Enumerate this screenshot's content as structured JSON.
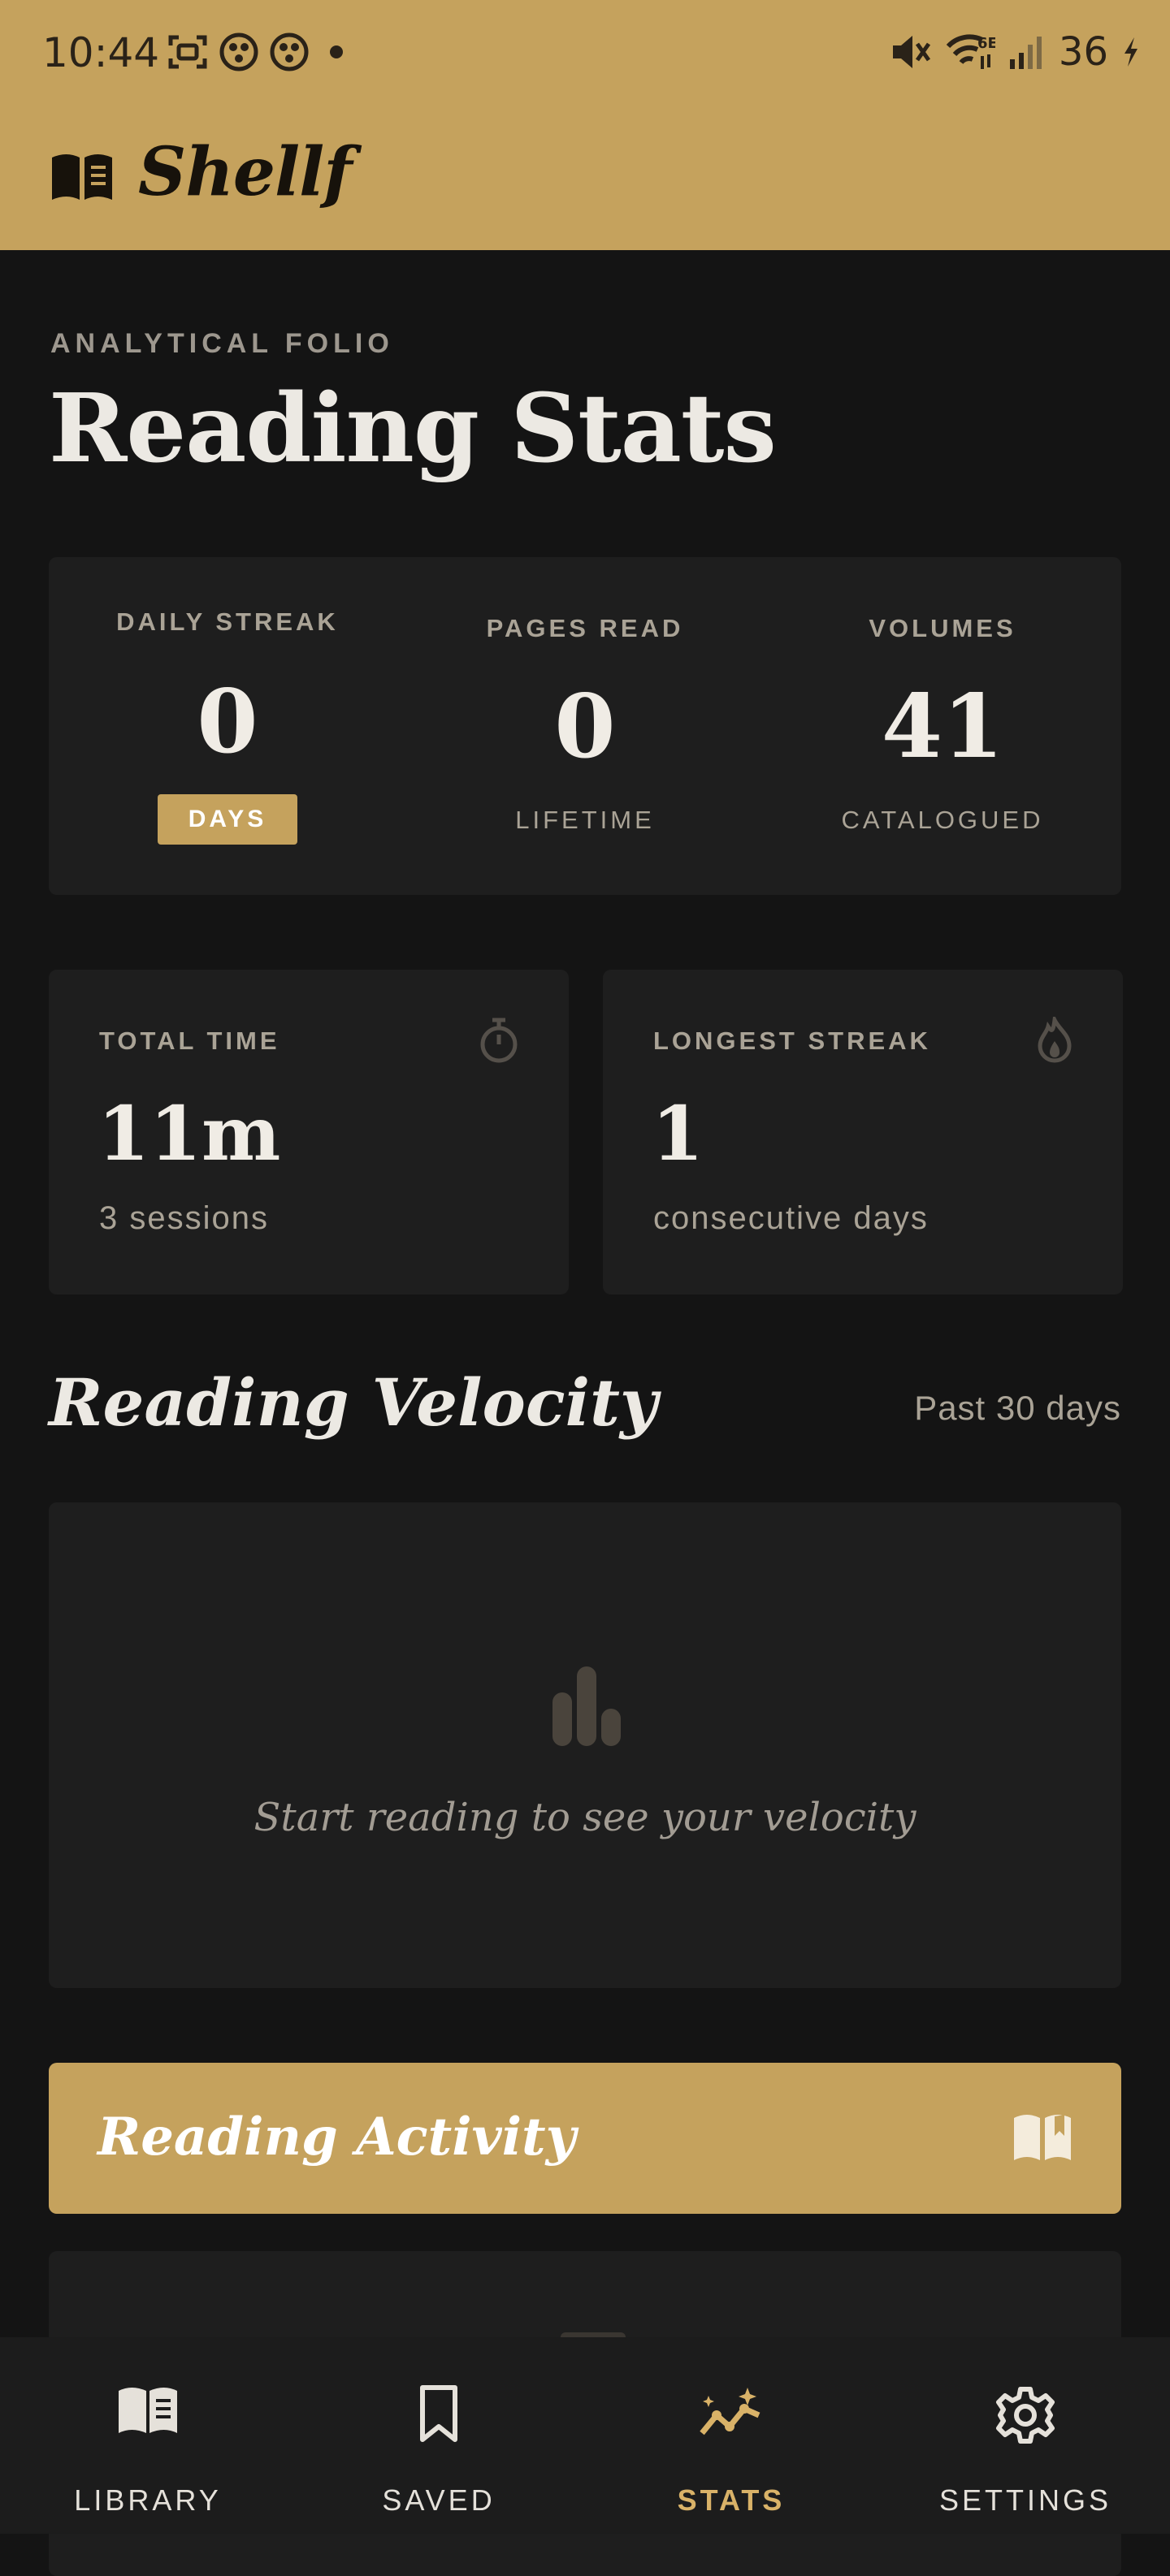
{
  "colors": {
    "accent": "#C5A25D",
    "background": "#141414",
    "card": "#1e1e1e",
    "text_primary": "#ece9e3",
    "text_muted": "#aaa396",
    "nav_active": "#D9B268"
  },
  "status_bar": {
    "time": "10:44",
    "battery": "36",
    "icons": [
      "screenshot-icon",
      "app-notification-icon",
      "app-notification-icon",
      "dot-icon",
      "mute-icon",
      "wifi-6e-icon",
      "signal-icon",
      "charging-icon"
    ]
  },
  "app": {
    "title": "Shellf",
    "logo_icon": "open-book-icon"
  },
  "page": {
    "eyebrow": "ANALYTICAL FOLIO",
    "title": "Reading Stats"
  },
  "summary": {
    "daily_streak": {
      "label": "DAILY STREAK",
      "value": "0",
      "sub": "DAYS"
    },
    "pages_read": {
      "label": "PAGES READ",
      "value": "0",
      "sub": "LIFETIME"
    },
    "volumes": {
      "label": "VOLUMES",
      "value": "41",
      "sub": "CATALOGUED"
    }
  },
  "total_time": {
    "label": "TOTAL TIME",
    "value": "11m",
    "sub": "3 sessions",
    "icon": "stopwatch-icon"
  },
  "longest_streak": {
    "label": "LONGEST STREAK",
    "value": "1",
    "sub": "consecutive days",
    "icon": "flame-icon"
  },
  "velocity": {
    "title": "Reading Velocity",
    "range": "Past 30 days",
    "empty_message": "Start reading to see your velocity",
    "icon": "bar-chart-icon"
  },
  "activity": {
    "title": "Reading Activity",
    "icon": "book-icon"
  },
  "bottom_nav": {
    "items": [
      {
        "label": "LIBRARY",
        "icon": "library-icon",
        "active": false
      },
      {
        "label": "SAVED",
        "icon": "bookmark-icon",
        "active": false
      },
      {
        "label": "STATS",
        "icon": "stats-icon",
        "active": true
      },
      {
        "label": "SETTINGS",
        "icon": "gear-icon",
        "active": false
      }
    ]
  }
}
